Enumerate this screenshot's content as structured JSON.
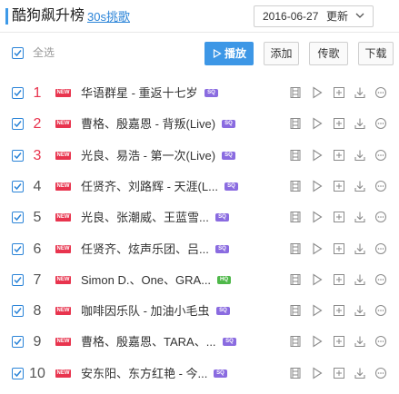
{
  "header": {
    "title": "酷狗飙升榜",
    "challenge_link": "30s挑歌",
    "date": "2016-06-27",
    "update_label": "更新"
  },
  "toolbar": {
    "select_all_label": "全选",
    "play_label": "播放",
    "add_label": "添加",
    "send_label": "传歌",
    "download_label": "下载"
  },
  "tags": {
    "new": "NEW",
    "sq": "SQ",
    "hq": "HQ"
  },
  "colors": {
    "accent": "#3d97e6",
    "rank_top": "#e8344e",
    "new_tag": "#e8344e",
    "sq_tag": "#8a6be0",
    "hq_tag": "#4fb84a"
  },
  "songs": [
    {
      "rank": "1",
      "title": "华语群星 - 重返十七岁",
      "quality": "sq"
    },
    {
      "rank": "2",
      "title": "曹格、殷嘉恩 - 背叛(Live)",
      "quality": "sq"
    },
    {
      "rank": "3",
      "title": "光良、易浩 - 第一次(Live)",
      "quality": "sq"
    },
    {
      "rank": "4",
      "title": "任贤齐、刘路辉 - 天涯(L...",
      "quality": "sq"
    },
    {
      "rank": "5",
      "title": "光良、张潮威、王蓝雪...",
      "quality": "sq"
    },
    {
      "rank": "6",
      "title": "任贤齐、炫声乐团、吕...",
      "quality": "sq"
    },
    {
      "rank": "7",
      "title": "Simon D.、One、GRA...",
      "quality": "hq"
    },
    {
      "rank": "8",
      "title": "咖啡因乐队 - 加油小毛虫",
      "quality": "sq"
    },
    {
      "rank": "9",
      "title": "曹格、殷嘉恩、TARA、...",
      "quality": "sq"
    },
    {
      "rank": "10",
      "title": "安东阳、东方红艳 - 今...",
      "quality": "sq"
    }
  ],
  "row_actions": [
    "mv-icon",
    "play-icon",
    "add-icon",
    "download-icon",
    "more-icon"
  ]
}
